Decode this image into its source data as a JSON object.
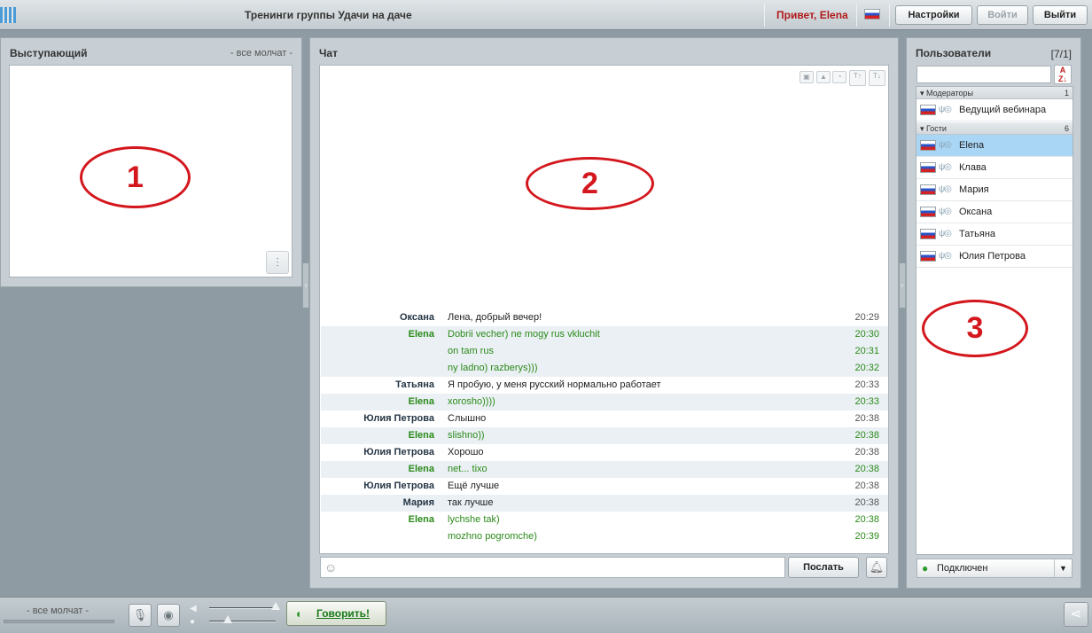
{
  "app": {
    "title": "Тренинги группы Удачи на даче",
    "greeting": "Привет, Elena"
  },
  "toolbar": {
    "settings_label": "Настройки",
    "login_label": "Войти",
    "logout_label": "Выйти"
  },
  "speaker": {
    "title": "Выступающий",
    "status": "- все молчат -",
    "annotation": "1"
  },
  "chat": {
    "title": "Чат",
    "annotation": "2",
    "send_label": "Послать",
    "messages": [
      {
        "author": "Оксана",
        "text": "Лена, добрый вечер!",
        "time": "20:29"
      },
      {
        "author": "Elena",
        "text": "Dobrii vecher) ne mogy rus vkluchit",
        "time": "20:30"
      },
      {
        "author": "",
        "text": "on tam rus",
        "time": "20:31"
      },
      {
        "author": "",
        "text": "ny ladno) razberys)))",
        "time": "20:32"
      },
      {
        "author": "Татьяна",
        "text": "Я пробую, у меня русский нормально работает",
        "time": "20:33"
      },
      {
        "author": "Elena",
        "text": "xorosho))))",
        "time": "20:33"
      },
      {
        "author": "Юлия Петрова",
        "text": "Слышно",
        "time": "20:38"
      },
      {
        "author": "Elena",
        "text": "slishno))",
        "time": "20:38"
      },
      {
        "author": "Юлия Петрова",
        "text": "Хорошо",
        "time": "20:38"
      },
      {
        "author": "Elena",
        "text": "net... tixo",
        "time": "20:38"
      },
      {
        "author": "Юлия Петрова",
        "text": "Ещё лучше",
        "time": "20:38"
      },
      {
        "author": "Мария",
        "text": "так лучше",
        "time": "20:38"
      },
      {
        "author": "Elena",
        "text": "lychshe tak)",
        "time": "20:38"
      },
      {
        "author": "",
        "text": "mozhno pogromche)",
        "time": "20:39"
      }
    ]
  },
  "users": {
    "title": "Пользователи",
    "count": "[7/1]",
    "annotation": "3",
    "moderators_label": "Модераторы",
    "moderators_count": "1",
    "guests_label": "Гости",
    "guests_count": "6",
    "moderators": [
      "Ведущий  вебинара"
    ],
    "guests": [
      "Elena",
      "Клава",
      "Мария",
      "Оксана",
      "Татьяна",
      "Юлия Петрова"
    ],
    "status_label": "Подключен"
  },
  "bottom": {
    "status": "- все молчат -",
    "talk_label": "Говорить!"
  },
  "colors": {
    "greeting": "#b01a1a",
    "own_message": "#2b8a19",
    "annotation": "#d4161d",
    "selected_user": "#a9d6f5"
  }
}
